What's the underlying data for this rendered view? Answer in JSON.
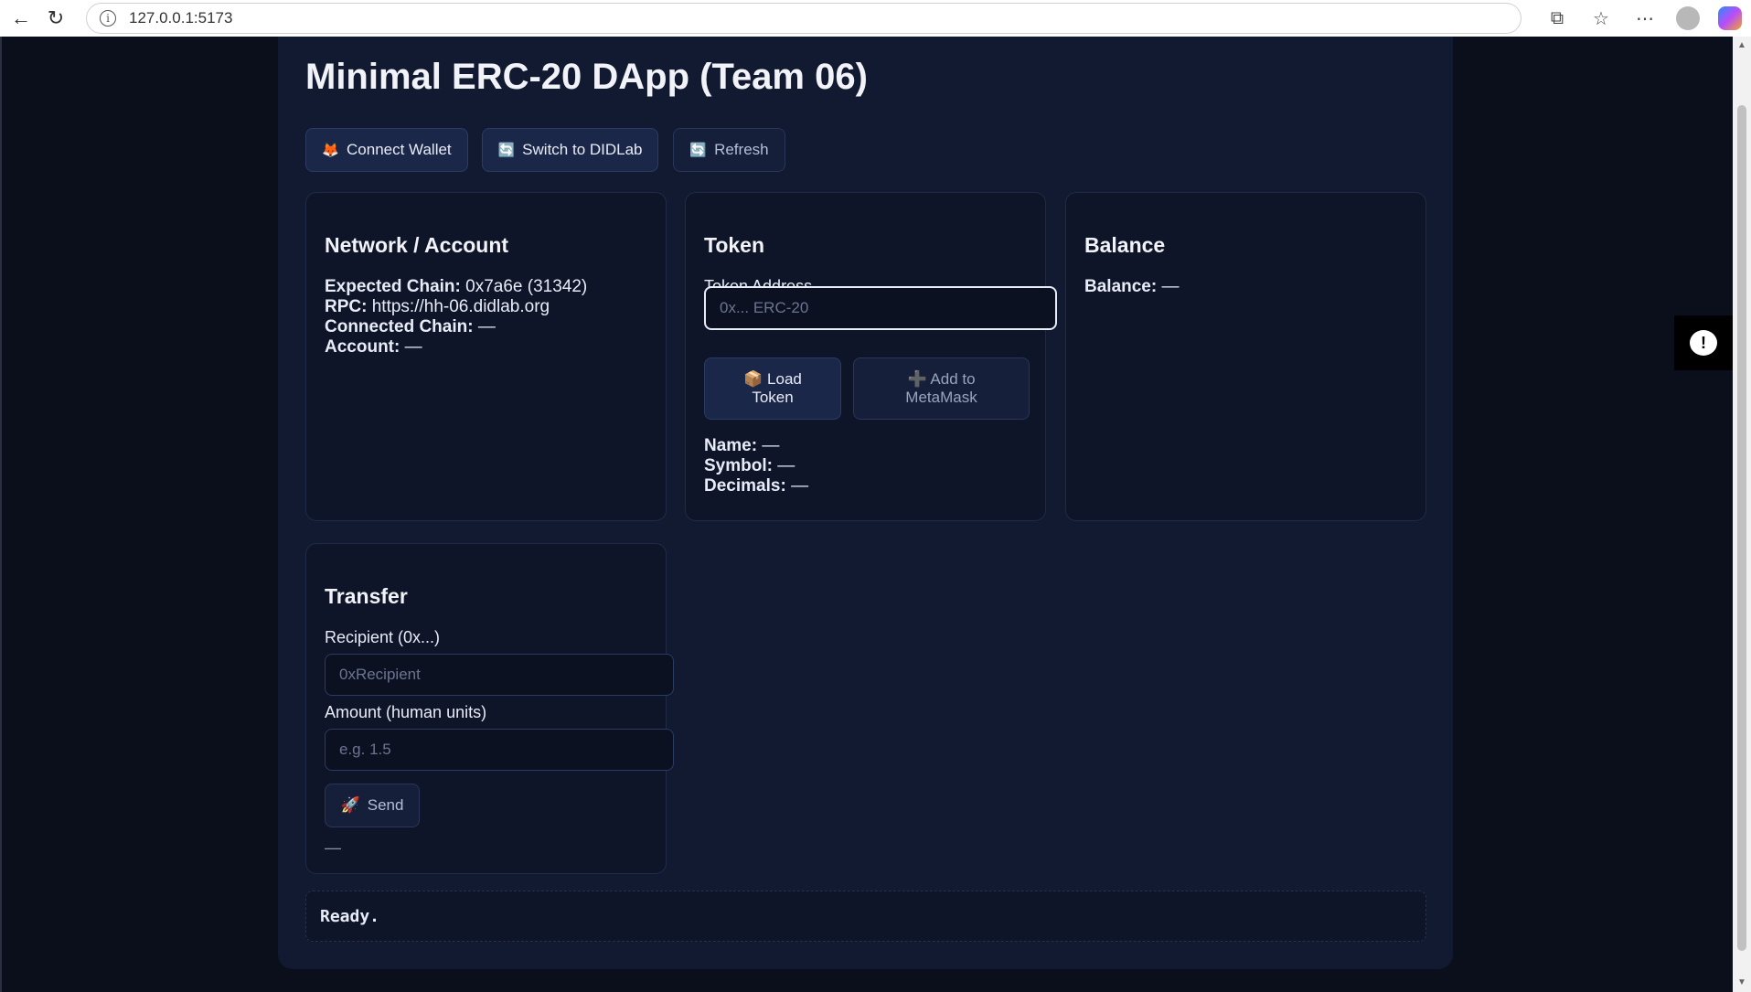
{
  "browser": {
    "url": "127.0.0.1:5173",
    "back_icon": "back-arrow-icon",
    "reload_icon": "reload-icon"
  },
  "app": {
    "title": "Minimal ERC-20 DApp (Team 06)",
    "buttons": {
      "connect": {
        "label": "Connect Wallet",
        "icon": "🦊"
      },
      "switch": {
        "label": "Switch to DIDLab",
        "icon": "🔄"
      },
      "refresh": {
        "label": "Refresh",
        "icon": "🔄"
      }
    }
  },
  "network": {
    "title": "Network / Account",
    "expected_chain_label": "Expected Chain:",
    "expected_chain_value": "0x7a6e (31342)",
    "rpc_label": "RPC:",
    "rpc_value": "https://hh-06.didlab.org",
    "connected_chain_label": "Connected Chain:",
    "connected_chain_value": "—",
    "account_label": "Account:",
    "account_value": "—"
  },
  "token": {
    "title": "Token",
    "address_label": "Token Address",
    "address_placeholder": "0x... ERC-20",
    "load_line1": "Load",
    "load_line2": "Token",
    "load_icon": "📦",
    "add_line1": "Add to",
    "add_line2": "MetaMask",
    "add_icon": "➕",
    "name_label": "Name:",
    "name_value": "—",
    "symbol_label": "Symbol:",
    "symbol_value": "—",
    "decimals_label": "Decimals:",
    "decimals_value": "—"
  },
  "balance": {
    "title": "Balance",
    "label": "Balance:",
    "value": "—"
  },
  "transfer": {
    "title": "Transfer",
    "recipient_label": "Recipient (0x...)",
    "recipient_placeholder": "0xRecipient",
    "amount_label": "Amount (human units)",
    "amount_placeholder": "e.g. 1.5",
    "send_label": "Send",
    "send_icon": "🚀",
    "status": "—"
  },
  "status_bar": {
    "text": "Ready."
  },
  "colors": {
    "background": "#0b0f1c",
    "panel": "#111a30",
    "card": "#0e1528",
    "button": "#1b2749",
    "border": "#2c3b63"
  }
}
